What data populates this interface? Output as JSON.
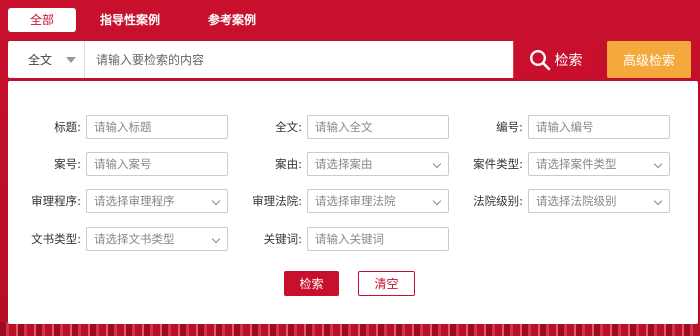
{
  "tabs": [
    {
      "label": "全部"
    },
    {
      "label": "指导性案例"
    },
    {
      "label": "参考案例"
    }
  ],
  "search": {
    "scope": "全文",
    "placeholder": "请输入要检索的内容",
    "search_label": "检索",
    "advanced_label": "高级检索"
  },
  "fields": {
    "title": {
      "label": "标题:",
      "placeholder": "请输入标题"
    },
    "fulltext": {
      "label": "全文:",
      "placeholder": "请输入全文"
    },
    "number": {
      "label": "编号:",
      "placeholder": "请输入编号"
    },
    "case_no": {
      "label": "案号:",
      "placeholder": "请输入案号"
    },
    "cause": {
      "label": "案由:",
      "placeholder": "请选择案由"
    },
    "case_type": {
      "label": "案件类型:",
      "placeholder": "请选择案件类型"
    },
    "procedure": {
      "label": "审理程序:",
      "placeholder": "请选择审理程序"
    },
    "court": {
      "label": "审理法院:",
      "placeholder": "请选择审理法院"
    },
    "court_level": {
      "label": "法院级别:",
      "placeholder": "请选择法院级别"
    },
    "doc_type": {
      "label": "文书类型:",
      "placeholder": "请选择文书类型"
    },
    "keyword": {
      "label": "关键词:",
      "placeholder": "请输入关键词"
    }
  },
  "actions": {
    "search_label": "检索",
    "clear_label": "清空"
  },
  "colors": {
    "brand_red": "#c8102e",
    "accent_orange": "#f5a83c"
  }
}
